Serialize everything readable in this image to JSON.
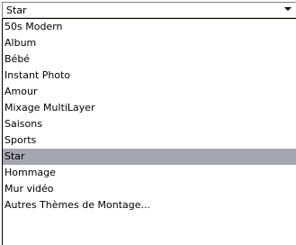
{
  "combo": {
    "selected_value": "Star",
    "arrow_icon": "triangle-down-icon"
  },
  "dropdown": {
    "selected_index": 8,
    "items": [
      {
        "label": "50s Modern"
      },
      {
        "label": "Album"
      },
      {
        "label": "Bébé"
      },
      {
        "label": "Instant Photo"
      },
      {
        "label": "Amour"
      },
      {
        "label": "Mixage MultiLayer"
      },
      {
        "label": "Saisons"
      },
      {
        "label": "Sports"
      },
      {
        "label": "Star"
      },
      {
        "label": "Hommage"
      },
      {
        "label": "Mur vidéo"
      },
      {
        "label": "Autres Thèmes de Montage..."
      }
    ]
  },
  "colors": {
    "selected_background": "#a6a6b0",
    "list_border": "#000000"
  }
}
